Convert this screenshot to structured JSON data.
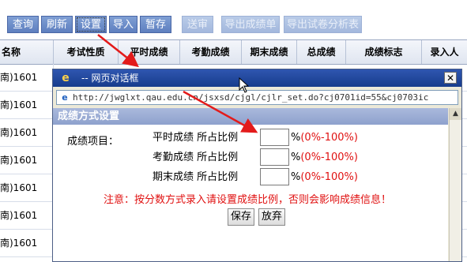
{
  "toolbar": {
    "buttons": [
      {
        "label": "查询"
      },
      {
        "label": "刷新"
      },
      {
        "label": "设置"
      },
      {
        "label": "导入"
      },
      {
        "label": "暂存"
      },
      {
        "label": "送审"
      },
      {
        "label": "导出成绩单"
      },
      {
        "label": "导出试卷分析表"
      }
    ]
  },
  "table": {
    "headers": [
      "名称",
      "考试性质",
      "平时成绩",
      "考勤成绩",
      "期末成绩",
      "总成绩",
      "成绩标志",
      "录入人"
    ],
    "rows": [
      "南)1601",
      "南)1601",
      "南)1601",
      "南)1601",
      "南)1601",
      "南)1601",
      "南)1601"
    ]
  },
  "dialog": {
    "title": "-- 网页对话框",
    "close": "✕",
    "url": "http://jwglxt.qau.edu.cn/jsxsd/cjgl/cjlr_set.do?cj0701id=55&cj0703ic",
    "section_title": "成绩方式设置",
    "project_label": "成绩项目：",
    "fields": [
      {
        "label": "平时成绩  所占比例",
        "value": "",
        "unit": "%",
        "range": "(0%-100%)"
      },
      {
        "label": "考勤成绩  所占比例",
        "value": "",
        "unit": "%",
        "range": "(0%-100%)"
      },
      {
        "label": "期末成绩  所占比例",
        "value": "",
        "unit": "%",
        "range": "(0%-100%)"
      }
    ],
    "note": "注意：按分数方式录入请设置成绩比例，否则会影响成绩信息！",
    "save_label": "保存",
    "cancel_label": "放弃"
  },
  "colors": {
    "accent": "#2f56b0",
    "warning": "#e01010",
    "arrow": "#e31b1b"
  }
}
